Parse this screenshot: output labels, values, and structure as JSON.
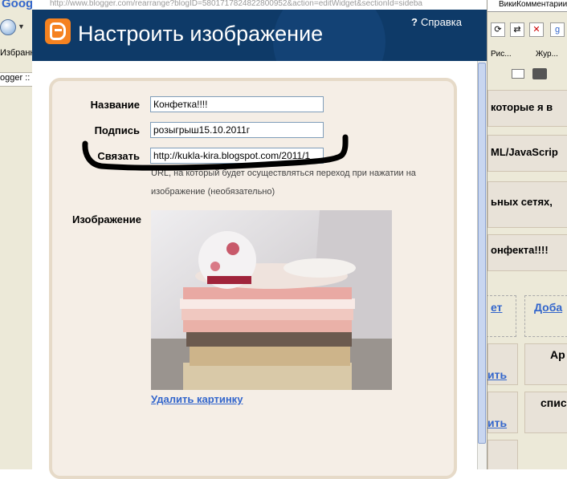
{
  "background_browser": {
    "google_logo": "Google",
    "tab_label": "Избранн",
    "tab2_label": "ogger ::",
    "right_tab": "ВикиКомментарии",
    "toolbar_items": [
      "Рис...",
      "Жур..."
    ],
    "blocks": [
      "которые я в",
      "ML/JavaScrip",
      "ьных сетях,",
      "онфекта!!!!",
      "ет",
      "Доба",
      "Ар",
      "ить",
      "спис",
      "ить"
    ]
  },
  "popup": {
    "url": "http://www.blogger.com/rearrange?blogID=5801717824822800952&action=editWidget&sectionId=sideba",
    "title": "Настроить изображение",
    "help_label": "Справка",
    "form": {
      "name_label": "Название",
      "name_value": "Конфетка!!!!",
      "caption_label": "Подпись",
      "caption_value": "розыгрыш15.10.2011г",
      "link_label": "Связать",
      "link_value": "http://kukla-kira.blogspot.com/2011/1",
      "link_hint": "URL, на который будет осуществляться переход при нажатии на изображение (необязательно)",
      "image_label": "Изображение",
      "delete_link": "Удалить картинку"
    }
  }
}
